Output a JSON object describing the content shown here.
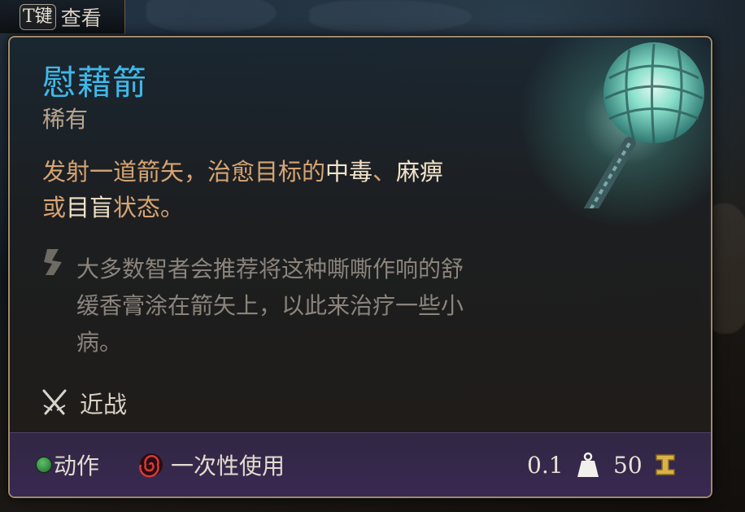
{
  "hint": {
    "key": "T键",
    "label": "查看"
  },
  "item": {
    "name": "慰藉箭",
    "rarity": "稀有",
    "description_parts": [
      "发射一道箭矢，治愈目标的",
      "中毒",
      "、",
      "麻痹",
      "或",
      "目盲",
      "状态。"
    ],
    "flavor_text": "大多数智者会推荐将这种嘶嘶作响的舒缓香膏涂在箭矢上，以此来治疗一些小病。",
    "weapon_type": "近战"
  },
  "footer": {
    "action_label": "动作",
    "consumable_label": "一次性使用",
    "weight": "0.1",
    "value": "50"
  },
  "colors": {
    "title": "#3fb8e8",
    "rarity": "#b8a58c",
    "description": "#d6a472",
    "highlight": "#f1e2c8",
    "flavor": "#8a847c",
    "border": "#a08a6a",
    "footer_bg": "#3a2852",
    "action_dot": "#3fa04c"
  },
  "icons": {
    "flavor": "quote-icon",
    "melee": "crossed-swords-icon",
    "action": "green-dot-icon",
    "consumable": "red-spiral-icon",
    "weight": "weight-icon",
    "value": "coin-icon"
  }
}
